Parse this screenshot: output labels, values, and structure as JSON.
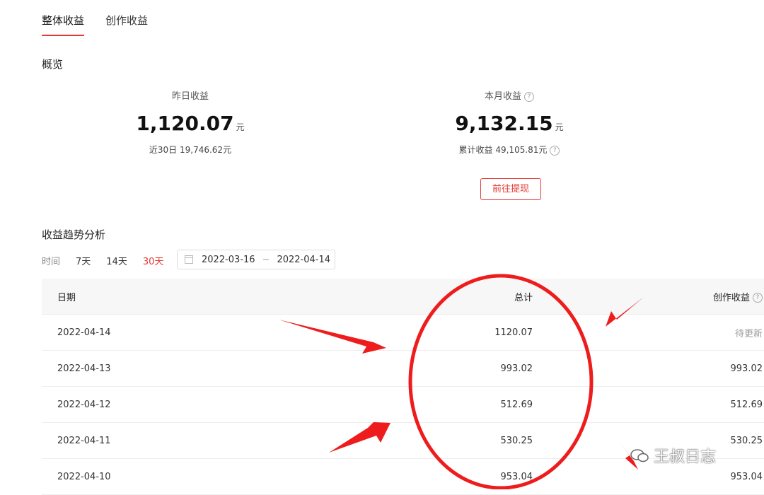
{
  "tabs": [
    "整体收益",
    "创作收益"
  ],
  "overview": {
    "title": "概览",
    "yesterday": {
      "label": "昨日收益",
      "value": "1,120.07",
      "unit": "元",
      "sub": "近30日 19,746.62元"
    },
    "month": {
      "label": "本月收益",
      "value": "9,132.15",
      "unit": "元",
      "sub": "累计收益 49,105.81元"
    },
    "withdraw_label": "前往提现"
  },
  "trend": {
    "title": "收益趋势分析",
    "time_label": "时间",
    "ranges": [
      "7天",
      "14天",
      "30天"
    ],
    "active_range": "30天",
    "date_start": "2022-03-16",
    "date_sep": "~",
    "date_end": "2022-04-14"
  },
  "table": {
    "headers": {
      "date": "日期",
      "total": "总计",
      "creation": "创作收益"
    },
    "rows": [
      {
        "date": "2022-04-14",
        "total": "1120.07",
        "creation": "待更新"
      },
      {
        "date": "2022-04-13",
        "total": "993.02",
        "creation": "993.02"
      },
      {
        "date": "2022-04-12",
        "total": "512.69",
        "creation": "512.69"
      },
      {
        "date": "2022-04-11",
        "total": "530.25",
        "creation": "530.25"
      },
      {
        "date": "2022-04-10",
        "total": "953.04",
        "creation": "953.04"
      }
    ]
  },
  "help_icon": "question-circle-icon",
  "watermark": "王叔日志",
  "colors": {
    "accent": "#e53935",
    "annotation": "#ee1c1c"
  }
}
